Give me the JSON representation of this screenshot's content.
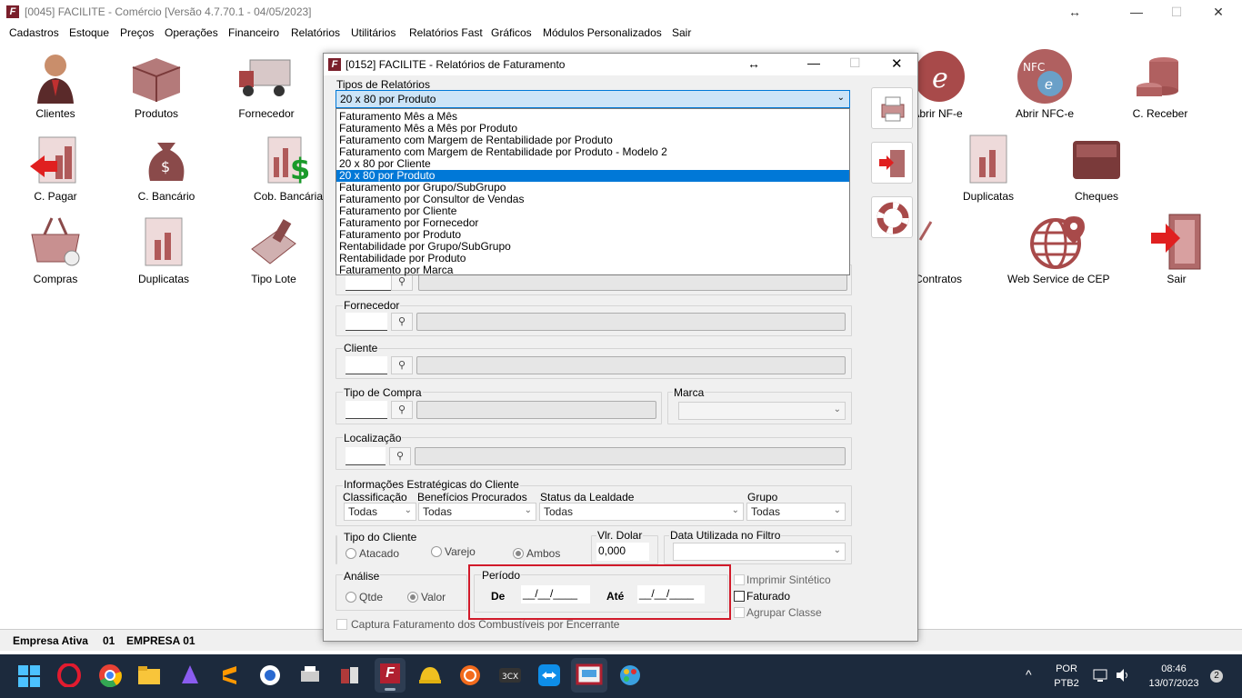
{
  "window": {
    "title": "[0045] FACILITE - Comércio [Versão 4.7.70.1 - 04/05/2023]",
    "app_icon_letter": "F",
    "controls": {
      "minimize": "—",
      "maximize": "☐",
      "close": "✕",
      "resize": "↔"
    }
  },
  "menu": [
    "Cadastros",
    "Estoque",
    "Preços",
    "Operações",
    "Financeiro",
    "Relatórios",
    "Utilitários",
    "Relatórios Fast",
    "Gráficos",
    "Módulos Personalizados",
    "Sair"
  ],
  "desktop_icons": [
    {
      "label": "Clientes",
      "icon": "person-icon"
    },
    {
      "label": "Produtos",
      "icon": "box-icon"
    },
    {
      "label": "Fornecedor",
      "icon": "truck-icon"
    },
    {
      "label": "C. Pagar",
      "icon": "chart-arrow-icon"
    },
    {
      "label": "C. Bancário",
      "icon": "money-bag-icon"
    },
    {
      "label": "Cob. Bancária",
      "icon": "dollar-doc-icon"
    },
    {
      "label": "Compras",
      "icon": "basket-icon"
    },
    {
      "label": "Duplicatas",
      "icon": "document-icon"
    },
    {
      "label": "Tipo Lote",
      "icon": "scanner-icon"
    },
    {
      "label": "Abrir NF-e",
      "icon": "nfe-icon"
    },
    {
      "label": "Abrir NFC-e",
      "icon": "nfce-icon"
    },
    {
      "label": "C. Receber",
      "icon": "coins-icon"
    },
    {
      "label": "Duplicatas",
      "icon": "document-icon"
    },
    {
      "label": "Cheques",
      "icon": "wallet-icon"
    },
    {
      "label": "Contratos",
      "icon": "contract-icon"
    },
    {
      "label": "Web Service de CEP",
      "icon": "globe-icon"
    },
    {
      "label": "Sair",
      "icon": "exit-door-icon"
    }
  ],
  "status_bar": {
    "label": "Empresa Ativa",
    "code": "01",
    "company": "EMPRESA 01"
  },
  "taskbar": {
    "lang": "POR",
    "layout": "PTB2",
    "time": "08:46",
    "date": "13/07/2023",
    "notifications": "2"
  },
  "dialog": {
    "title": "[0152] FACILITE - Relatórios de Faturamento",
    "report_types_label": "Tipos de Relatórios",
    "selected_report": "20 x 80 por Produto",
    "report_options": [
      "Faturamento Mês a Mês",
      "Faturamento Mês a Mês por Produto",
      "Faturamento com Margem de Rentabilidade por Produto",
      "Faturamento com Margem de Rentabilidade por Produto - Modelo 2",
      "20 x 80 por Cliente",
      "20 x 80 por Produto",
      "Faturamento por Grupo/SubGrupo",
      "Faturamento por Consultor de Vendas",
      "Faturamento por Cliente",
      "Faturamento por Fornecedor",
      "Faturamento por Produto",
      "Rentabilidade por Grupo/SubGrupo",
      "Rentabilidade por Produto",
      "Faturamento por Marca"
    ],
    "selected_index": 5,
    "fornecedor_label": "Fornecedor",
    "cliente_label": "Cliente",
    "tipo_compra_label": "Tipo de Compra",
    "marca_label": "Marca",
    "localizacao_label": "Localização",
    "info_estrategicas": {
      "title": "Informações Estratégicas do Cliente",
      "classificacao": {
        "label": "Classificação",
        "value": "Todas"
      },
      "beneficios": {
        "label": "Benefícios Procurados",
        "value": "Todas"
      },
      "status_lealdade": {
        "label": "Status da Lealdade",
        "value": "Todas"
      },
      "grupo": {
        "label": "Grupo",
        "value": "Todas"
      }
    },
    "tipo_cliente": {
      "label": "Tipo do Cliente",
      "options": [
        "Atacado",
        "Varejo",
        "Ambos"
      ],
      "selected": "Ambos"
    },
    "vlr_dolar": {
      "label": "Vlr. Dolar",
      "value": "0,000"
    },
    "data_filtro": {
      "label": "Data Utilizada no Filtro",
      "value": ""
    },
    "analise": {
      "label": "Análise",
      "options": [
        "Qtde",
        "Valor"
      ],
      "selected": "Valor"
    },
    "periodo": {
      "label": "Período",
      "de_label": "De",
      "de_value": "__/__/____",
      "ate_label": "Até",
      "ate_value": "__/__/____"
    },
    "checks": {
      "imprimir_sintetico": "Imprimir Sintético",
      "faturado": "Faturado",
      "agrupar_classe": "Agrupar Classe",
      "captura": "Captura Faturamento dos Combustíveis por Encerrante"
    },
    "empty_code": "______"
  }
}
